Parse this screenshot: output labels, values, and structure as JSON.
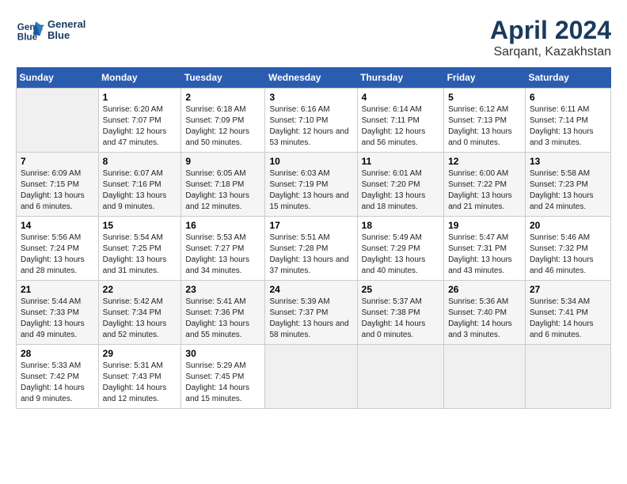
{
  "header": {
    "logo_line1": "General",
    "logo_line2": "Blue",
    "title": "April 2024",
    "subtitle": "Sarqant, Kazakhstan"
  },
  "days_of_week": [
    "Sunday",
    "Monday",
    "Tuesday",
    "Wednesday",
    "Thursday",
    "Friday",
    "Saturday"
  ],
  "weeks": [
    [
      {
        "num": "",
        "sunrise": "",
        "sunset": "",
        "daylight": ""
      },
      {
        "num": "1",
        "sunrise": "Sunrise: 6:20 AM",
        "sunset": "Sunset: 7:07 PM",
        "daylight": "Daylight: 12 hours and 47 minutes."
      },
      {
        "num": "2",
        "sunrise": "Sunrise: 6:18 AM",
        "sunset": "Sunset: 7:09 PM",
        "daylight": "Daylight: 12 hours and 50 minutes."
      },
      {
        "num": "3",
        "sunrise": "Sunrise: 6:16 AM",
        "sunset": "Sunset: 7:10 PM",
        "daylight": "Daylight: 12 hours and 53 minutes."
      },
      {
        "num": "4",
        "sunrise": "Sunrise: 6:14 AM",
        "sunset": "Sunset: 7:11 PM",
        "daylight": "Daylight: 12 hours and 56 minutes."
      },
      {
        "num": "5",
        "sunrise": "Sunrise: 6:12 AM",
        "sunset": "Sunset: 7:13 PM",
        "daylight": "Daylight: 13 hours and 0 minutes."
      },
      {
        "num": "6",
        "sunrise": "Sunrise: 6:11 AM",
        "sunset": "Sunset: 7:14 PM",
        "daylight": "Daylight: 13 hours and 3 minutes."
      }
    ],
    [
      {
        "num": "7",
        "sunrise": "Sunrise: 6:09 AM",
        "sunset": "Sunset: 7:15 PM",
        "daylight": "Daylight: 13 hours and 6 minutes."
      },
      {
        "num": "8",
        "sunrise": "Sunrise: 6:07 AM",
        "sunset": "Sunset: 7:16 PM",
        "daylight": "Daylight: 13 hours and 9 minutes."
      },
      {
        "num": "9",
        "sunrise": "Sunrise: 6:05 AM",
        "sunset": "Sunset: 7:18 PM",
        "daylight": "Daylight: 13 hours and 12 minutes."
      },
      {
        "num": "10",
        "sunrise": "Sunrise: 6:03 AM",
        "sunset": "Sunset: 7:19 PM",
        "daylight": "Daylight: 13 hours and 15 minutes."
      },
      {
        "num": "11",
        "sunrise": "Sunrise: 6:01 AM",
        "sunset": "Sunset: 7:20 PM",
        "daylight": "Daylight: 13 hours and 18 minutes."
      },
      {
        "num": "12",
        "sunrise": "Sunrise: 6:00 AM",
        "sunset": "Sunset: 7:22 PM",
        "daylight": "Daylight: 13 hours and 21 minutes."
      },
      {
        "num": "13",
        "sunrise": "Sunrise: 5:58 AM",
        "sunset": "Sunset: 7:23 PM",
        "daylight": "Daylight: 13 hours and 24 minutes."
      }
    ],
    [
      {
        "num": "14",
        "sunrise": "Sunrise: 5:56 AM",
        "sunset": "Sunset: 7:24 PM",
        "daylight": "Daylight: 13 hours and 28 minutes."
      },
      {
        "num": "15",
        "sunrise": "Sunrise: 5:54 AM",
        "sunset": "Sunset: 7:25 PM",
        "daylight": "Daylight: 13 hours and 31 minutes."
      },
      {
        "num": "16",
        "sunrise": "Sunrise: 5:53 AM",
        "sunset": "Sunset: 7:27 PM",
        "daylight": "Daylight: 13 hours and 34 minutes."
      },
      {
        "num": "17",
        "sunrise": "Sunrise: 5:51 AM",
        "sunset": "Sunset: 7:28 PM",
        "daylight": "Daylight: 13 hours and 37 minutes."
      },
      {
        "num": "18",
        "sunrise": "Sunrise: 5:49 AM",
        "sunset": "Sunset: 7:29 PM",
        "daylight": "Daylight: 13 hours and 40 minutes."
      },
      {
        "num": "19",
        "sunrise": "Sunrise: 5:47 AM",
        "sunset": "Sunset: 7:31 PM",
        "daylight": "Daylight: 13 hours and 43 minutes."
      },
      {
        "num": "20",
        "sunrise": "Sunrise: 5:46 AM",
        "sunset": "Sunset: 7:32 PM",
        "daylight": "Daylight: 13 hours and 46 minutes."
      }
    ],
    [
      {
        "num": "21",
        "sunrise": "Sunrise: 5:44 AM",
        "sunset": "Sunset: 7:33 PM",
        "daylight": "Daylight: 13 hours and 49 minutes."
      },
      {
        "num": "22",
        "sunrise": "Sunrise: 5:42 AM",
        "sunset": "Sunset: 7:34 PM",
        "daylight": "Daylight: 13 hours and 52 minutes."
      },
      {
        "num": "23",
        "sunrise": "Sunrise: 5:41 AM",
        "sunset": "Sunset: 7:36 PM",
        "daylight": "Daylight: 13 hours and 55 minutes."
      },
      {
        "num": "24",
        "sunrise": "Sunrise: 5:39 AM",
        "sunset": "Sunset: 7:37 PM",
        "daylight": "Daylight: 13 hours and 58 minutes."
      },
      {
        "num": "25",
        "sunrise": "Sunrise: 5:37 AM",
        "sunset": "Sunset: 7:38 PM",
        "daylight": "Daylight: 14 hours and 0 minutes."
      },
      {
        "num": "26",
        "sunrise": "Sunrise: 5:36 AM",
        "sunset": "Sunset: 7:40 PM",
        "daylight": "Daylight: 14 hours and 3 minutes."
      },
      {
        "num": "27",
        "sunrise": "Sunrise: 5:34 AM",
        "sunset": "Sunset: 7:41 PM",
        "daylight": "Daylight: 14 hours and 6 minutes."
      }
    ],
    [
      {
        "num": "28",
        "sunrise": "Sunrise: 5:33 AM",
        "sunset": "Sunset: 7:42 PM",
        "daylight": "Daylight: 14 hours and 9 minutes."
      },
      {
        "num": "29",
        "sunrise": "Sunrise: 5:31 AM",
        "sunset": "Sunset: 7:43 PM",
        "daylight": "Daylight: 14 hours and 12 minutes."
      },
      {
        "num": "30",
        "sunrise": "Sunrise: 5:29 AM",
        "sunset": "Sunset: 7:45 PM",
        "daylight": "Daylight: 14 hours and 15 minutes."
      },
      {
        "num": "",
        "sunrise": "",
        "sunset": "",
        "daylight": ""
      },
      {
        "num": "",
        "sunrise": "",
        "sunset": "",
        "daylight": ""
      },
      {
        "num": "",
        "sunrise": "",
        "sunset": "",
        "daylight": ""
      },
      {
        "num": "",
        "sunrise": "",
        "sunset": "",
        "daylight": ""
      }
    ]
  ]
}
